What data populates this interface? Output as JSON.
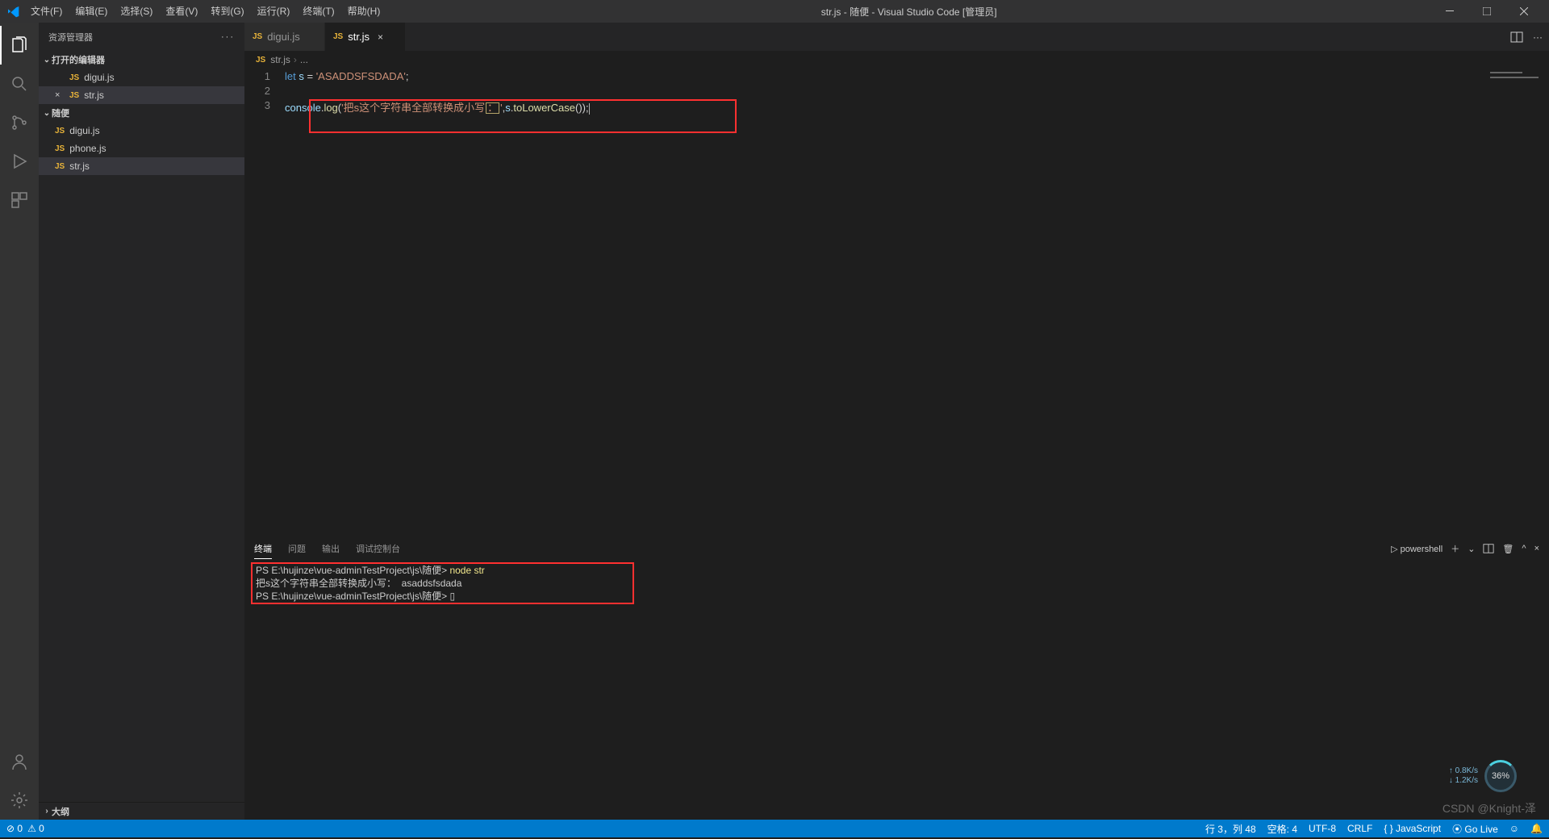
{
  "title": "str.js - 随便 - Visual Studio Code [管理员]",
  "menu": [
    "文件(F)",
    "编辑(E)",
    "选择(S)",
    "查看(V)",
    "转到(G)",
    "运行(R)",
    "终端(T)",
    "帮助(H)"
  ],
  "sidebar": {
    "header": "资源管理器",
    "open_editors_title": "打开的编辑器",
    "open_editors": [
      {
        "name": "digui.js"
      },
      {
        "name": "str.js",
        "active": true
      }
    ],
    "folder_title": "随便",
    "files": [
      {
        "name": "digui.js"
      },
      {
        "name": "phone.js"
      },
      {
        "name": "str.js",
        "active": true
      }
    ],
    "outline_title": "大纲"
  },
  "tabs": [
    {
      "name": "digui.js",
      "active": false
    },
    {
      "name": "str.js",
      "active": true
    }
  ],
  "breadcrumb": {
    "file": "str.js",
    "more": "..."
  },
  "code": {
    "l1_kw": "let",
    "l1_var": " s ",
    "l1_eq": "= ",
    "l1_str": "'ASADDSFSDADA'",
    "l1_semi": ";",
    "l3_obj": "console",
    "l3_dot": ".",
    "l3_fn": "log",
    "l3_p1": "(",
    "l3_str1": "'把s这个字符串全部转换成小写",
    "l3_boxch": "：",
    "l3_str2": "'",
    "l3_comma": ",",
    "l3_s": "s",
    "l3_dot2": ".",
    "l3_fn2": "toLowerCase",
    "l3_p2": "())",
    "l3_semi": ";"
  },
  "lines": [
    "1",
    "2",
    "3"
  ],
  "panel": {
    "tabs": [
      "终端",
      "问题",
      "输出",
      "调试控制台"
    ],
    "shell_label": "powershell",
    "prompt1_path": "PS E:\\hujinze\\vue-adminTestProject\\js\\随便> ",
    "prompt1_cmd": "node str",
    "out_line": "把s这个字符串全部转换成小写：  asaddsfsdada",
    "prompt2_path": "PS E:\\hujinze\\vue-adminTestProject\\js\\随便> ",
    "cursor_box": "▯"
  },
  "status": {
    "left_errs": "⊘ 0",
    "left_warn": "⚠ 0",
    "ln_col": "行 3，列 48",
    "spaces": "空格: 4",
    "enc": "UTF-8",
    "eol": "CRLF",
    "lang": "{ } JavaScript",
    "golive": "⦿ Go Live",
    "feedback": "☺",
    "bell": "🔔"
  },
  "net": {
    "up": "↑ 0.8K/s",
    "down": "↓ 1.2K/s",
    "pct": "36%"
  },
  "watermark": "CSDN @Knight-泽"
}
